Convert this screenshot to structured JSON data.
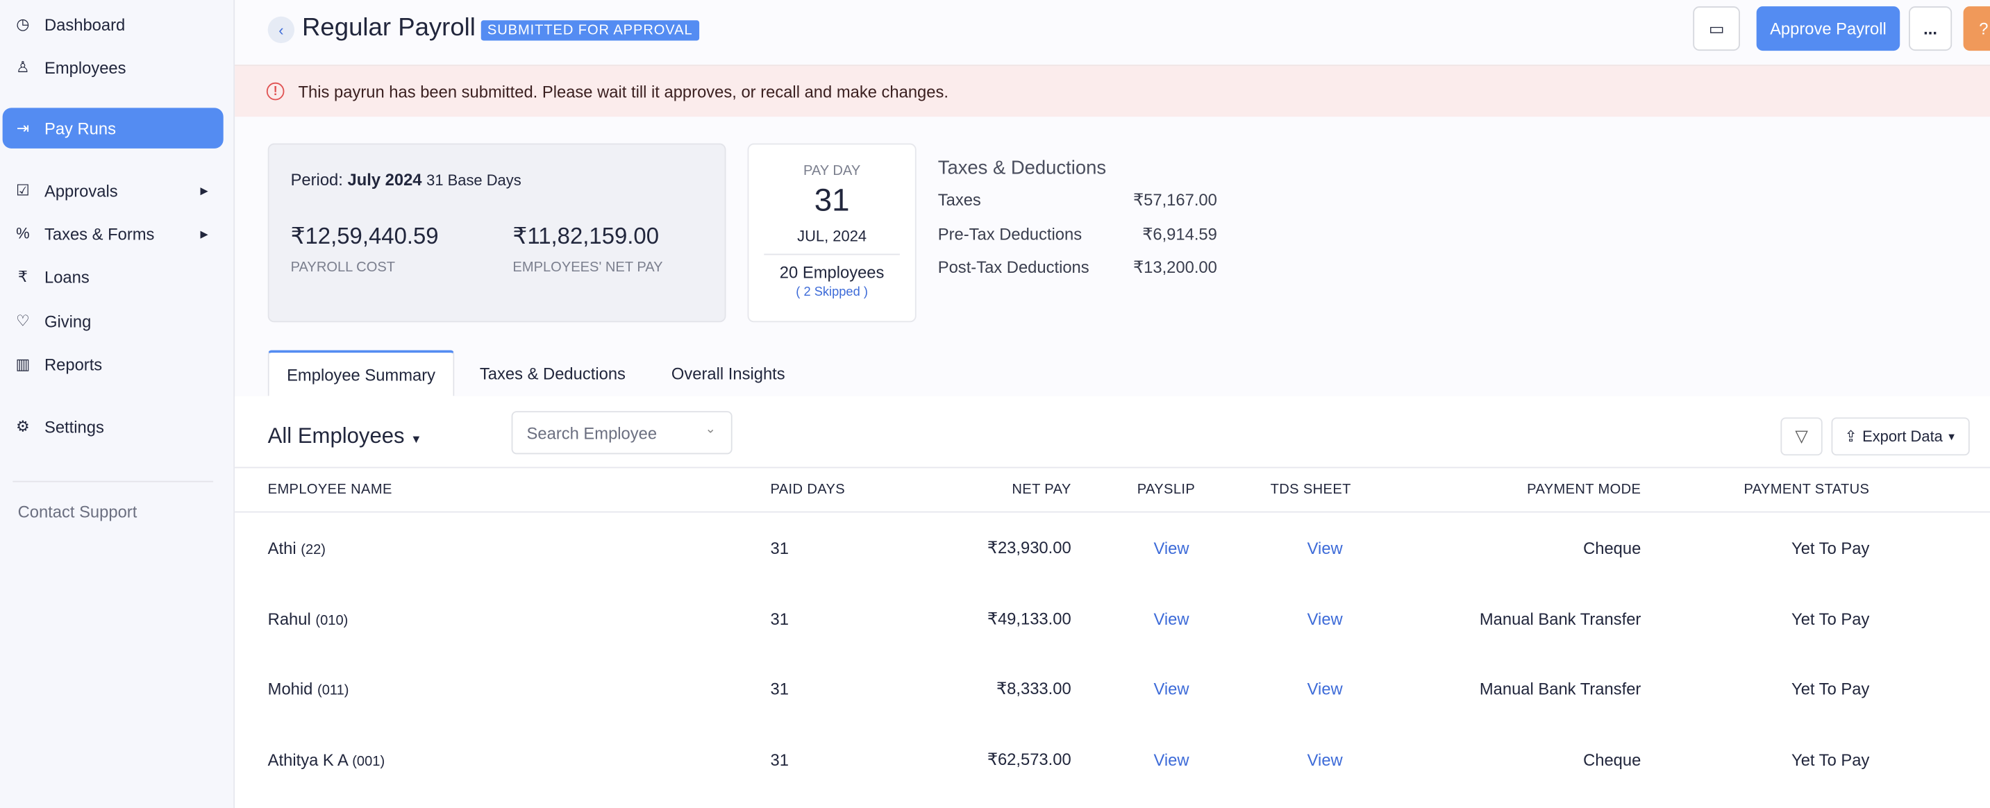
{
  "sidebar": {
    "items": [
      {
        "label": "Dashboard",
        "icon": "dashboard-icon"
      },
      {
        "label": "Employees",
        "icon": "user-icon"
      },
      {
        "label": "Pay Runs",
        "icon": "calendar-arrow-icon",
        "active": true
      },
      {
        "label": "Approvals",
        "icon": "checklist-icon",
        "expandable": true
      },
      {
        "label": "Taxes & Forms",
        "icon": "percent-doc-icon",
        "expandable": true
      },
      {
        "label": "Loans",
        "icon": "rupee-icon"
      },
      {
        "label": "Giving",
        "icon": "heart-icon"
      },
      {
        "label": "Reports",
        "icon": "report-icon"
      },
      {
        "label": "Settings",
        "icon": "gear-icon"
      }
    ],
    "contact_support": "Contact Support"
  },
  "header": {
    "title": "Regular Payroll",
    "status": "SUBMITTED FOR APPROVAL",
    "approve_label": "Approve Payroll",
    "more_label": "...",
    "help_label": "?"
  },
  "alert": {
    "text": "This payrun has been submitted. Please wait till it approves, or recall and make changes."
  },
  "summary": {
    "period_label": "Period:",
    "period": "July 2024",
    "base_days": "31 Base Days",
    "payroll_cost": "₹12,59,440.59",
    "payroll_cost_label": "PAYROLL COST",
    "net_pay": "₹11,82,159.00",
    "net_pay_label": "EMPLOYEES' NET PAY"
  },
  "payday": {
    "label": "PAY DAY",
    "day": "31",
    "month_year": "JUL, 2024",
    "employees": "20 Employees",
    "skipped": "( 2 Skipped )"
  },
  "taxes": {
    "title": "Taxes & Deductions",
    "rows": [
      {
        "label": "Taxes",
        "value": "₹57,167.00"
      },
      {
        "label": "Pre-Tax Deductions",
        "value": "₹6,914.59"
      },
      {
        "label": "Post-Tax Deductions",
        "value": "₹13,200.00"
      }
    ]
  },
  "tabs": [
    {
      "label": "Employee Summary",
      "active": true
    },
    {
      "label": "Taxes & Deductions"
    },
    {
      "label": "Overall Insights"
    }
  ],
  "list": {
    "filter_label": "All Employees",
    "search_placeholder": "Search Employee",
    "export_label": "Export Data",
    "columns": [
      "EMPLOYEE NAME",
      "PAID DAYS",
      "NET PAY",
      "PAYSLIP",
      "TDS SHEET",
      "PAYMENT MODE",
      "PAYMENT STATUS"
    ],
    "rows": [
      {
        "name": "Athi",
        "id": "(22)",
        "paid_days": "31",
        "net_pay": "₹23,930.00",
        "payslip": "View",
        "tds": "View",
        "mode": "Cheque",
        "status": "Yet To Pay"
      },
      {
        "name": "Rahul",
        "id": "(010)",
        "paid_days": "31",
        "net_pay": "₹49,133.00",
        "payslip": "View",
        "tds": "View",
        "mode": "Manual Bank Transfer",
        "status": "Yet To Pay"
      },
      {
        "name": "Mohid",
        "id": "(011)",
        "paid_days": "31",
        "net_pay": "₹8,333.00",
        "payslip": "View",
        "tds": "View",
        "mode": "Manual Bank Transfer",
        "status": "Yet To Pay"
      },
      {
        "name": "Athitya K A",
        "id": "(001)",
        "paid_days": "31",
        "net_pay": "₹62,573.00",
        "payslip": "View",
        "tds": "View",
        "mode": "Cheque",
        "status": "Yet To Pay"
      }
    ]
  },
  "colors": {
    "accent": "#548cf2",
    "alert_bg": "#fbecec",
    "help": "#f0995a"
  }
}
